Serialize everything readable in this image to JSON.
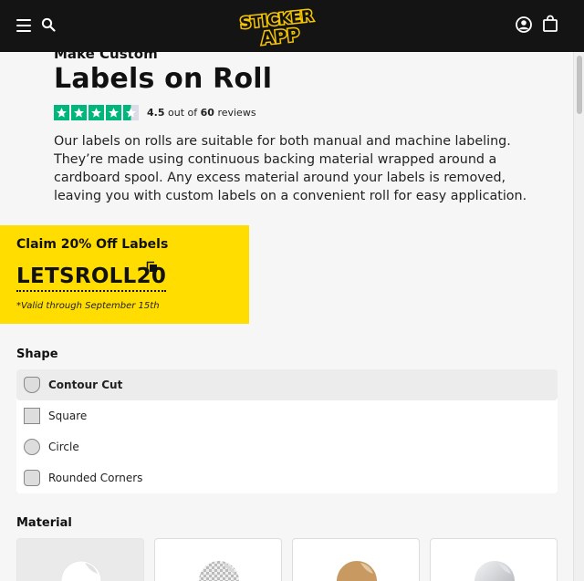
{
  "header": {
    "logo_line1": "STICKER",
    "logo_line2": "APP",
    "icons": [
      "menu-icon",
      "search-icon",
      "account-icon",
      "cart-icon"
    ]
  },
  "product": {
    "kicker": "Make Custom",
    "title": "Labels on Roll",
    "rating": {
      "score": "4.5",
      "out_of": "out of",
      "count": "60",
      "count_suffix": "reviews",
      "stars": 4.5,
      "star_color": "#00b67a"
    },
    "description": "Our labels on rolls are suitable for both manual and machine labeling. They’re made using continuous backing material wrapped around a cardboard spool. Any excess material around your labels is removed, leaving you with custom labels on a convenient roll for easy application."
  },
  "promo": {
    "heading": "Claim 20% Off Labels",
    "code": "LETSROLL20",
    "validity": "*Valid through September 15th",
    "background": "#ffdd00"
  },
  "shape": {
    "label": "Shape",
    "options": [
      {
        "label": "Contour Cut",
        "icon": "contour-cut-icon",
        "selected": true
      },
      {
        "label": "Square",
        "icon": "square-icon",
        "selected": false
      },
      {
        "label": "Circle",
        "icon": "circle-icon",
        "selected": false
      },
      {
        "label": "Rounded Corners",
        "icon": "rounded-corners-icon",
        "selected": false
      }
    ]
  },
  "material": {
    "label": "Material",
    "options": [
      {
        "icon": "white-material-icon",
        "selected": true
      },
      {
        "icon": "clear-material-icon",
        "selected": false
      },
      {
        "icon": "kraft-material-icon",
        "selected": false
      },
      {
        "icon": "silver-material-icon",
        "selected": false
      }
    ]
  }
}
